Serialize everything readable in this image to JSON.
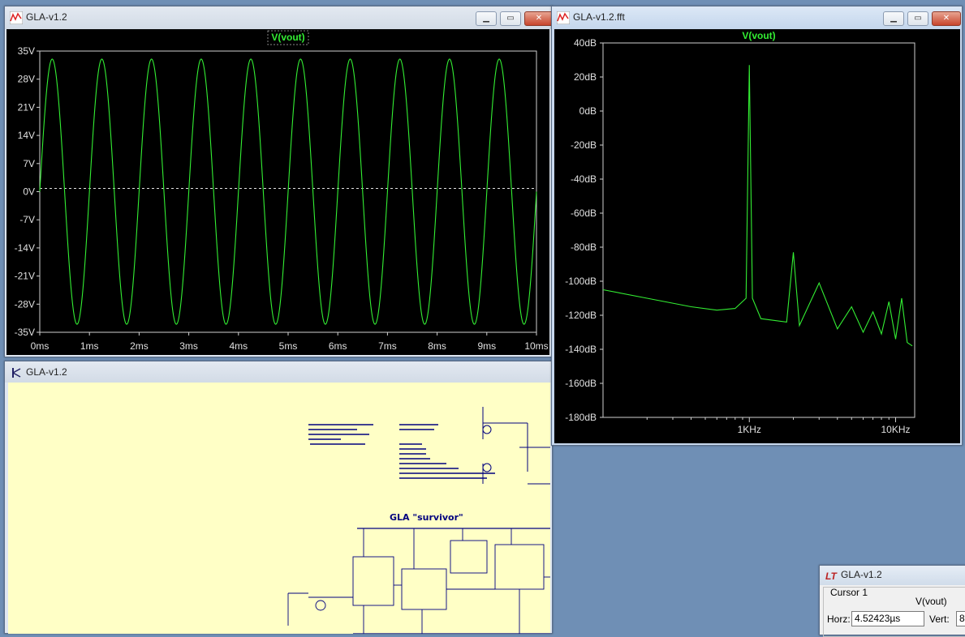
{
  "waveform_window": {
    "title": "GLA-v1.2",
    "trace_label": "V(vout)",
    "y_ticks": [
      "35V",
      "28V",
      "21V",
      "14V",
      "7V",
      "0V",
      "-7V",
      "-14V",
      "-21V",
      "-28V",
      "-35V"
    ],
    "x_ticks": [
      "0ms",
      "1ms",
      "2ms",
      "3ms",
      "4ms",
      "5ms",
      "6ms",
      "7ms",
      "8ms",
      "9ms",
      "10ms"
    ],
    "trace_color": "#33ee33"
  },
  "fft_window": {
    "title": "GLA-v1.2.fft",
    "trace_label": "V(vout)",
    "y_ticks": [
      "40dB",
      "20dB",
      "0dB",
      "-20dB",
      "-40dB",
      "-60dB",
      "-80dB",
      "-100dB",
      "-120dB",
      "-140dB",
      "-160dB",
      "-180dB"
    ],
    "x_ticks": [
      "1KHz",
      "10KHz"
    ]
  },
  "schematic_window": {
    "title": "GLA-v1.2",
    "circuit_title": "GLA \"survivor\""
  },
  "cursor_dialog": {
    "title": "GLA-v1.2",
    "cursor_label": "Cursor 1",
    "trace_name": "V(vout)",
    "horz_label": "Horz:",
    "horz_value": "4.52423µs",
    "vert_label": "Vert:",
    "vert_value": "8"
  },
  "chart_data": [
    {
      "type": "line",
      "title": "V(vout)",
      "xlabel": "",
      "ylabel": "",
      "x_unit": "ms",
      "y_unit": "V",
      "xlim": [
        0,
        10
      ],
      "ylim": [
        -35,
        35
      ],
      "series": [
        {
          "name": "V(vout)",
          "waveform": "sine",
          "frequency_khz": 1,
          "amplitude_v": 33,
          "offset_v": 0
        }
      ],
      "grid": false,
      "reference_line_y": 0
    },
    {
      "type": "line",
      "title": "V(vout)",
      "xlabel": "",
      "ylabel": "",
      "x_unit": "Hz",
      "y_unit": "dB",
      "x_scale": "log",
      "ylim": [
        -180,
        40
      ],
      "series": [
        {
          "name": "V(vout)",
          "x": [
            100,
            200,
            400,
            600,
            800,
            950,
            1000,
            1050,
            1200,
            1800,
            2000,
            2200,
            3000,
            4000,
            5000,
            6000,
            7000,
            8000,
            9000,
            10000,
            11000,
            12000,
            13000
          ],
          "y": [
            -105,
            -110,
            -115,
            -117,
            -116,
            -110,
            27,
            -110,
            -122,
            -124,
            -83,
            -126,
            -101,
            -128,
            -115,
            -130,
            -118,
            -131,
            -112,
            -134,
            -110,
            -136,
            -138
          ]
        }
      ],
      "grid": false
    }
  ]
}
